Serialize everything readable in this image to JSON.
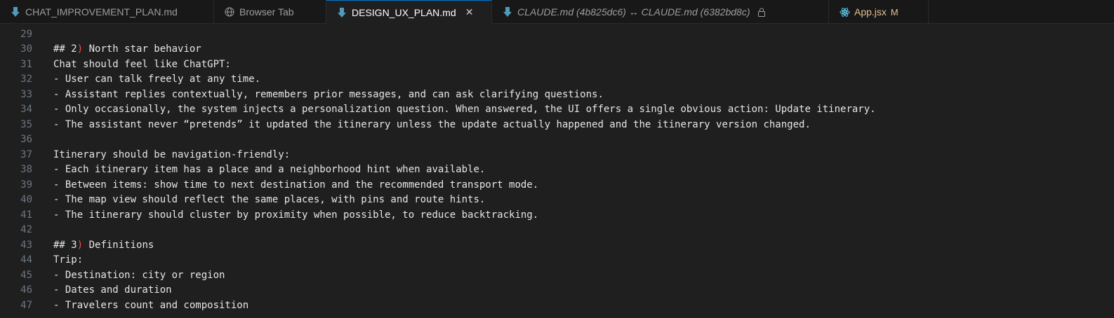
{
  "tabs": [
    {
      "label": "CHAT_IMPROVEMENT_PLAN.md",
      "icon": "markdown-arrow-icon",
      "active": false
    },
    {
      "label": "Browser Tab",
      "icon": "globe-icon",
      "active": false
    },
    {
      "label": "DESIGN_UX_PLAN.md",
      "icon": "markdown-arrow-icon",
      "active": true,
      "close": "✕"
    },
    {
      "label": "CLAUDE.md (4b825dc6) ↔ CLAUDE.md (6382bd8c)",
      "icon": "diff-icon",
      "active": false
    },
    {
      "label": "App.jsx",
      "icon": "react-icon",
      "active": false,
      "badge": "M"
    }
  ],
  "editor": {
    "lines": [
      {
        "n": "29",
        "text": ""
      },
      {
        "n": "30",
        "pre": "## 2",
        "paren": ")",
        "post": " North star behavior"
      },
      {
        "n": "31",
        "text": "Chat should feel like ChatGPT:"
      },
      {
        "n": "32",
        "text": "- User can talk freely at any time."
      },
      {
        "n": "33",
        "text": "- Assistant replies contextually, remembers prior messages, and can ask clarifying questions."
      },
      {
        "n": "34",
        "text": "- Only occasionally, the system injects a personalization question. When answered, the UI offers a single obvious action: Update itinerary."
      },
      {
        "n": "35",
        "text": "- The assistant never “pretends” it updated the itinerary unless the update actually happened and the itinerary version changed."
      },
      {
        "n": "36",
        "text": ""
      },
      {
        "n": "37",
        "text": "Itinerary should be navigation-friendly:"
      },
      {
        "n": "38",
        "text": "- Each itinerary item has a place and a neighborhood hint when available."
      },
      {
        "n": "39",
        "text": "- Between items: show time to next destination and the recommended transport mode."
      },
      {
        "n": "40",
        "text": "- The map view should reflect the same places, with pins and route hints."
      },
      {
        "n": "41",
        "text": "- The itinerary should cluster by proximity when possible, to reduce backtracking."
      },
      {
        "n": "42",
        "text": ""
      },
      {
        "n": "43",
        "pre": "## 3",
        "paren": ")",
        "post": " Definitions"
      },
      {
        "n": "44",
        "text": "Trip:"
      },
      {
        "n": "45",
        "text": "- Destination: city or region"
      },
      {
        "n": "46",
        "text": "- Dates and duration"
      },
      {
        "n": "47",
        "text": "- Travelers count and composition"
      }
    ]
  },
  "colors": {
    "accent": "#0078d4",
    "markdown_icon": "#519aba",
    "react_icon": "#61dafb",
    "modified": "#e2c08d",
    "paren": "#f14c4c"
  }
}
